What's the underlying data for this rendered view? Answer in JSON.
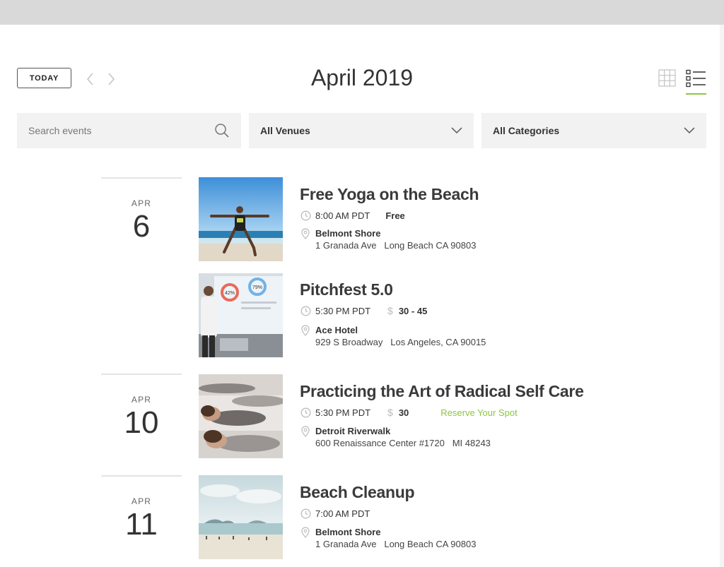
{
  "header": {
    "today_label": "TODAY",
    "month_title": "April 2019"
  },
  "icons": {
    "prev": "chevron-left-icon",
    "next": "chevron-right-icon",
    "grid_view": "grid-view-icon",
    "list_view": "list-view-icon",
    "search": "search-icon",
    "dropdown": "chevron-down-icon",
    "time": "clock-icon",
    "location": "location-pin-icon",
    "cost": "dollar-icon"
  },
  "filters": {
    "search_placeholder": "Search events",
    "venues": "All Venues",
    "categories": "All Categories"
  },
  "colors": {
    "accent": "#8dc63f",
    "filter_bg": "#f2f2f2",
    "top_bar": "#d9d9d9"
  },
  "dates": [
    {
      "month": "APR",
      "day": "6"
    },
    {
      "month": "APR",
      "day": "10"
    },
    {
      "month": "APR",
      "day": "11"
    }
  ],
  "events": [
    {
      "title": "Free Yoga on the Beach",
      "time": "8:00 AM PDT",
      "cost": "Free",
      "venue": "Belmont Shore",
      "address": "1 Granada Ave",
      "city": "Long Beach CA 90803"
    },
    {
      "title": "Pitchfest 5.0",
      "time": "5:30 PM PDT",
      "cost": "30 - 45",
      "venue": "Ace Hotel",
      "address": "929 S Broadway",
      "city": "Los Angeles, CA 90015"
    },
    {
      "title": "Practicing the Art of Radical Self Care",
      "time": "5:30 PM PDT",
      "cost": "30",
      "reserve": "Reserve Your Spot",
      "venue": "Detroit Riverwalk",
      "address": "600 Renaissance Center #1720",
      "city": "MI 48243"
    },
    {
      "title": "Beach Cleanup",
      "time": "7:00 AM PDT",
      "venue": "Belmont Shore",
      "address": "1 Granada Ave",
      "city": "Long Beach CA 90803"
    }
  ],
  "thumb_labels": [
    "42%",
    "79%"
  ]
}
